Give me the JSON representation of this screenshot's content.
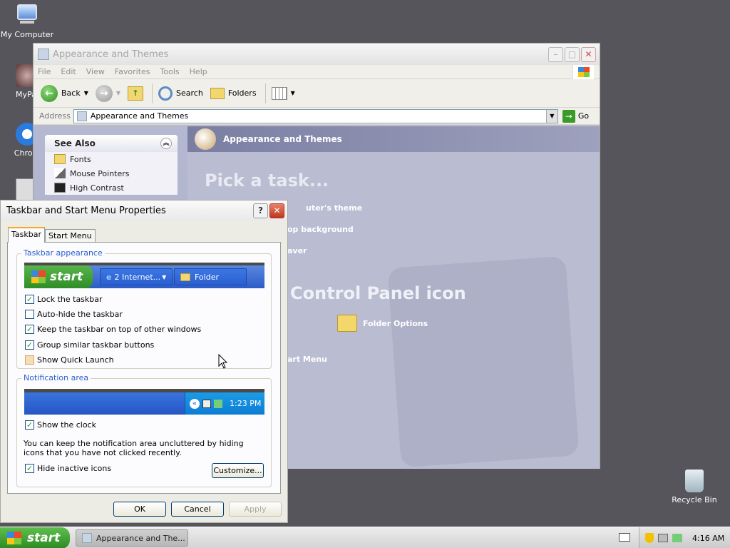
{
  "desktop": {
    "icons": [
      {
        "label": "My Computer"
      },
      {
        "label": "MyPal"
      },
      {
        "label": "Chrom"
      },
      {
        "label": "Recycle Bin"
      }
    ]
  },
  "explorer": {
    "title": "Appearance and Themes",
    "menu": [
      "File",
      "Edit",
      "View",
      "Favorites",
      "Tools",
      "Help"
    ],
    "toolbar": {
      "back": "Back",
      "search": "Search",
      "folders": "Folders"
    },
    "address_label": "Address",
    "address_value": "Appearance and Themes",
    "go": "Go",
    "see_also": {
      "title": "See Also",
      "items": [
        "Fonts",
        "Mouse Pointers",
        "High Contrast"
      ]
    },
    "header": "Appearance and Themes",
    "pick_task": "Pick a task...",
    "tasks": [
      "uter's theme",
      "op background",
      "aver"
    ],
    "or_pick": "Control Panel icon",
    "folder_options": "Folder Options",
    "start_menu_link": "art Menu"
  },
  "dialog": {
    "title": "Taskbar and Start Menu Properties",
    "tabs": [
      "Taskbar",
      "Start Menu"
    ],
    "appearance_group": "Taskbar appearance",
    "preview_start": "start",
    "preview_ie": "2 Internet...",
    "preview_folder": "Folder",
    "options": [
      {
        "label": "Lock the taskbar",
        "checked": true
      },
      {
        "label": "Auto-hide the taskbar",
        "checked": false
      },
      {
        "label": "Keep the taskbar on top of other windows",
        "checked": true
      },
      {
        "label": "Group similar taskbar buttons",
        "checked": true
      },
      {
        "label": "Show Quick Launch",
        "checked": false
      }
    ],
    "notification_group": "Notification area",
    "preview_time": "1:23 PM",
    "show_clock": "Show the clock",
    "note": "You can keep the notification area uncluttered by hiding icons that you have not clicked recently.",
    "hide_inactive": "Hide inactive icons",
    "customize": "Customize...",
    "ok": "OK",
    "cancel": "Cancel",
    "apply": "Apply"
  },
  "taskbar": {
    "start": "start",
    "item": "Appearance and The...",
    "time": "4:16 AM"
  }
}
